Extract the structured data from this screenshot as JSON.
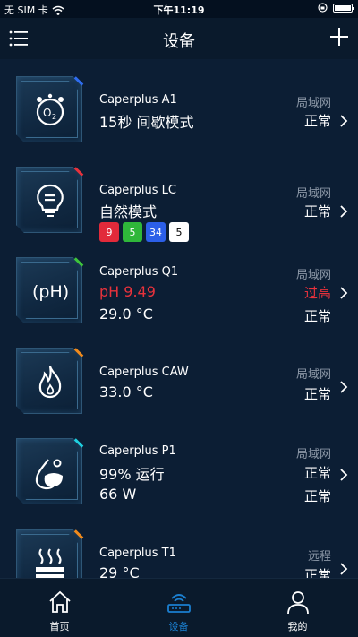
{
  "status_bar": {
    "carrier": "无 SIM 卡",
    "wifi_icon": "wifi-icon",
    "time": "下午11:19",
    "battery_icon": "battery-icon"
  },
  "navbar": {
    "title": "设备",
    "menu_icon": "list-menu-icon",
    "add_icon": "plus-icon"
  },
  "devices": [
    {
      "name": "Caperplus A1",
      "icon": "o2-icon",
      "corner_color": "#2f6df0",
      "lines": [
        "15秒 间歇模式"
      ],
      "connection": "局域网",
      "statuses": [
        "正常"
      ]
    },
    {
      "name": "Caperplus LC",
      "icon": "bulb-icon",
      "corner_color": "#e8323c",
      "lines": [
        "自然模式"
      ],
      "badges": [
        {
          "value": "9",
          "color": "#e22a3a"
        },
        {
          "value": "5",
          "color": "#2fb73a"
        },
        {
          "value": "34",
          "color": "#2c5fe8"
        },
        {
          "value": "5",
          "color": "#ffffff"
        }
      ],
      "connection": "局域网",
      "statuses": [
        "正常"
      ]
    },
    {
      "name": "Caperplus Q1",
      "icon": "ph-icon",
      "corner_color": "#3ec43b",
      "lines": [
        "pH 9.49",
        "29.0 °C"
      ],
      "connection": "局域网",
      "statuses": [
        "过高",
        "正常"
      ]
    },
    {
      "name": "Caperplus CAW",
      "icon": "flame-icon",
      "corner_color": "#f08a1c",
      "lines": [
        "33.0 °C"
      ],
      "connection": "局域网",
      "statuses": [
        "正常"
      ]
    },
    {
      "name": "Caperplus P1",
      "icon": "water-drop-icon",
      "corner_color": "#1fd0e0",
      "lines": [
        "99% 运行",
        "66 W"
      ],
      "connection": "局域网",
      "statuses": [
        "正常",
        "正常"
      ]
    },
    {
      "name": "Caperplus T1",
      "icon": "heater-icon",
      "corner_color": "#f08a1c",
      "lines": [
        "29 °C"
      ],
      "connection": "远程",
      "statuses": [
        "正常"
      ]
    }
  ],
  "tabbar": {
    "tabs": [
      {
        "label": "首页",
        "icon": "home-icon"
      },
      {
        "label": "设备",
        "icon": "router-icon",
        "active": true
      },
      {
        "label": "我的",
        "icon": "user-icon"
      }
    ]
  },
  "colors": {
    "background": "#0a1a2c",
    "list_background": "#0c1e34",
    "accent": "#1b7fd0",
    "alert": "#e8323c",
    "muted": "#8b97a6"
  }
}
